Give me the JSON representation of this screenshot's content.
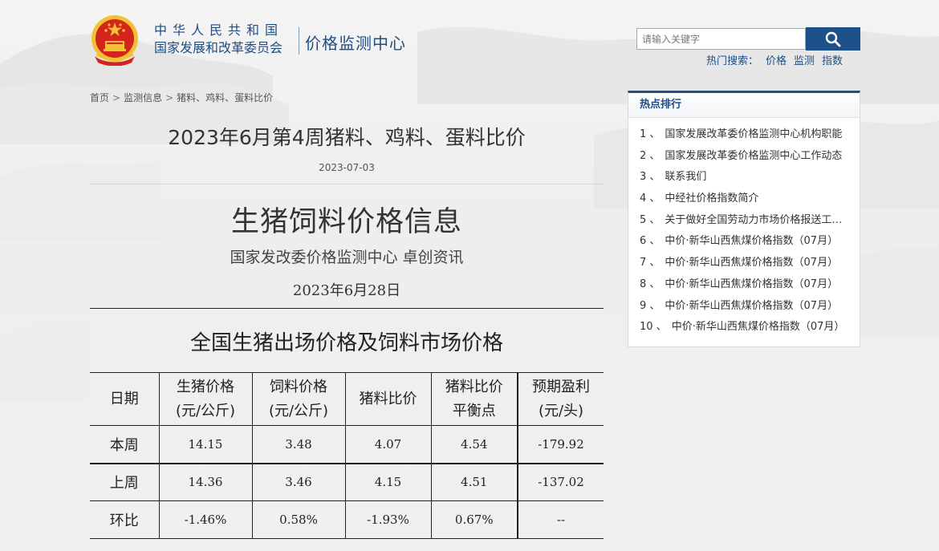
{
  "header": {
    "org_line1": "中华人民共和国",
    "org_line2": "国家发展和改革委员会",
    "center_name": "价格监测中心"
  },
  "search": {
    "placeholder": "请输入关键字",
    "hot_label": "热门搜索：",
    "hot_terms": [
      "价格",
      "监测",
      "指数"
    ]
  },
  "breadcrumb": {
    "items": [
      "首页",
      "监测信息",
      "猪料、鸡料、蛋料比价"
    ],
    "separator": ">"
  },
  "article": {
    "title": "2023年6月第4周猪料、鸡料、蛋料比价",
    "date": "2023-07-03",
    "heading": "生猪饲料价格信息",
    "source": "国家发改委价格监测中心  卓创资讯",
    "publish_date": "2023年6月28日",
    "table_title": "全国生猪出场价格及饲料市场价格"
  },
  "table": {
    "headers": [
      [
        "日期"
      ],
      [
        "生猪价格",
        "(元/公斤)"
      ],
      [
        "饲料价格",
        "(元/公斤)"
      ],
      [
        "猪料比价"
      ],
      [
        "猪料比价",
        "平衡点"
      ],
      [
        "预期盈利",
        "(元/头)"
      ]
    ],
    "rows": [
      [
        "本周",
        "14.15",
        "3.48",
        "4.07",
        "4.54",
        "-179.92"
      ],
      [
        "上周",
        "14.36",
        "3.46",
        "4.15",
        "4.51",
        "-137.02"
      ],
      [
        "环比",
        "-1.46%",
        "0.58%",
        "-1.93%",
        "0.67%",
        "--"
      ]
    ]
  },
  "sidebar": {
    "title": "热点排行",
    "items": [
      {
        "num": "1 、",
        "text": "国家发展改革委价格监测中心机构职能"
      },
      {
        "num": "2 、",
        "text": "国家发展改革委价格监测中心工作动态"
      },
      {
        "num": "3 、",
        "text": "联系我们"
      },
      {
        "num": "4 、",
        "text": "中经社价格指数简介"
      },
      {
        "num": "5 、",
        "text": "关于做好全国劳动力市场价格报送工作的通知"
      },
      {
        "num": "6 、",
        "text": "中价·新华山西焦煤价格指数（07月）"
      },
      {
        "num": "7 、",
        "text": "中价·新华山西焦煤价格指数（07月）"
      },
      {
        "num": "8 、",
        "text": "中价·新华山西焦煤价格指数（07月）"
      },
      {
        "num": "9 、",
        "text": "中价·新华山西焦煤价格指数（07月）"
      },
      {
        "num": "10 、",
        "text": "中价·新华山西焦煤价格指数（07月）"
      }
    ]
  },
  "colors": {
    "brand_blue": "#1f4d84",
    "search_button": "#1e5189",
    "emblem_red": "#d3251b",
    "emblem_gold": "#f2c232"
  },
  "icons": {
    "search": "magnifier-icon",
    "emblem": "national-emblem-icon"
  }
}
